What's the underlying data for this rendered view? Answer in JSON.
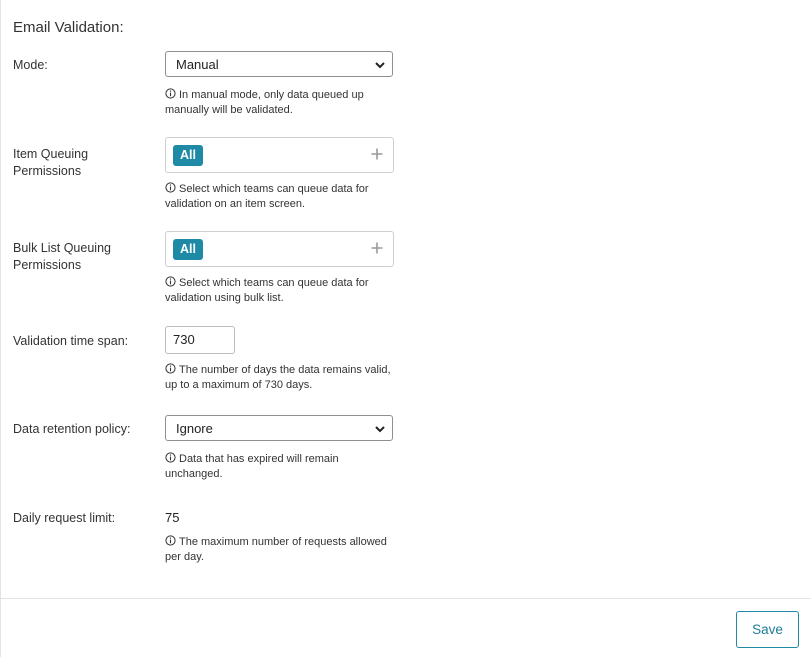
{
  "section": {
    "title": "Email Validation:"
  },
  "mode": {
    "label": "Mode:",
    "value": "Manual",
    "help": "In manual mode, only data queued up manually will be validated."
  },
  "item_queuing": {
    "label": "Item Queuing Permissions",
    "tag": "All",
    "help": "Select which teams can queue data for validation on an item screen."
  },
  "bulk_queuing": {
    "label": "Bulk List Queuing Permissions",
    "tag": "All",
    "help": "Select which teams can queue data for validation using bulk list."
  },
  "time_span": {
    "label": "Validation time span:",
    "value": "730",
    "help": "The number of days the data remains valid, up to a maximum of 730 days."
  },
  "retention": {
    "label": "Data retention policy:",
    "value": "Ignore",
    "help": "Data that has expired will remain unchanged."
  },
  "daily_limit": {
    "label": "Daily request limit:",
    "value": "75",
    "help": "The maximum number of requests allowed per day."
  },
  "footer": {
    "save_label": "Save"
  },
  "colors": {
    "accent": "#1e8aa6",
    "tag_bg": "#1e8aa6",
    "border": "#cfcfcf"
  },
  "icons": {
    "info": "info-circle-icon",
    "chevron": "chevron-down-icon",
    "plus": "plus-icon"
  }
}
